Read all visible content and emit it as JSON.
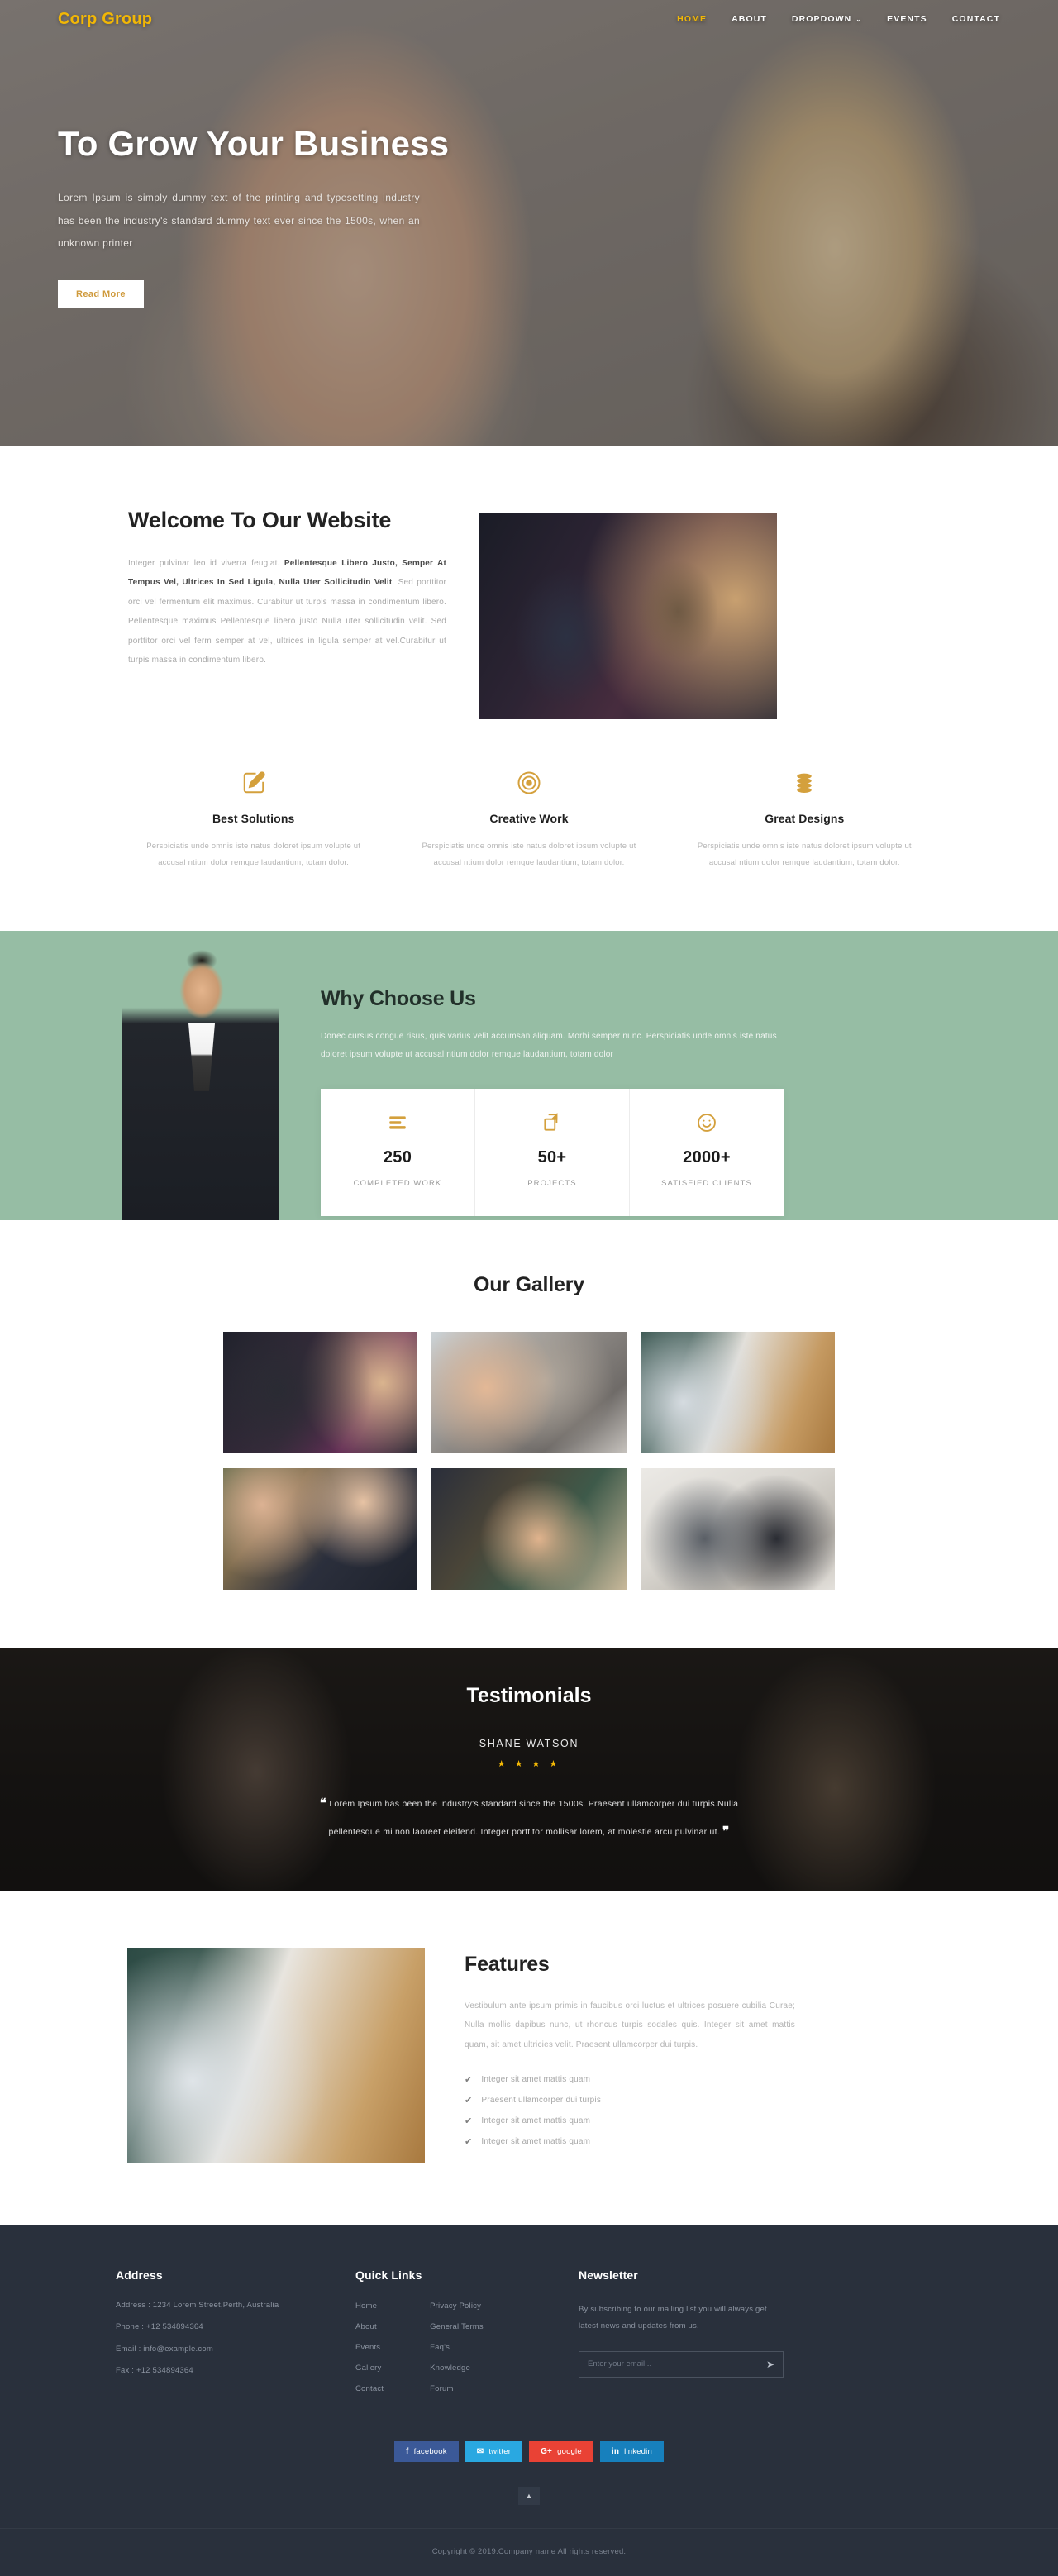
{
  "brand": {
    "logo": "Corp Group",
    "accent": "#f2b705",
    "green": "#96bda4",
    "footer_bg": "#29303c"
  },
  "nav": {
    "items": [
      {
        "label": "HOME",
        "active": true
      },
      {
        "label": "ABOUT",
        "active": false
      },
      {
        "label": "DROPDOWN",
        "active": false,
        "caret": "⌄"
      },
      {
        "label": "EVENTS",
        "active": false
      },
      {
        "label": "CONTACT",
        "active": false
      }
    ]
  },
  "hero": {
    "title": "To Grow Your Business",
    "desc": "Lorem Ipsum is simply dummy text of the printing and typesetting industry has been the industry's standard dummy text ever since the 1500s, when an unknown printer",
    "button": "Read More"
  },
  "welcome": {
    "title": "Welcome To Our Website",
    "lead": "Integer pulvinar leo id viverra feugiat. ",
    "bold": "Pellentesque Libero Justo, Semper At Tempus Vel, Ultrices In Sed Ligula, Nulla Uter Sollicitudin Velit",
    "rest": ". Sed porttitor orci vel fermentum elit maximus. Curabitur ut turpis massa in condimentum libero. Pellentesque maximus Pellentesque libero justo Nulla uter sollicitudin velit. Sed porttitor orci vel ferm semper at vel, ultrices in ligula semper at vel.Curabitur ut turpis massa in condimentum libero."
  },
  "services": [
    {
      "icon": "pencil-edit-icon",
      "title": "Best Solutions",
      "desc": "Perspiciatis unde omnis iste natus doloret ipsum volupte ut accusal ntium dolor remque laudantium, totam dolor."
    },
    {
      "icon": "target-icon",
      "title": "Creative Work",
      "desc": "Perspiciatis unde omnis iste natus doloret ipsum volupte ut accusal ntium dolor remque laudantium, totam dolor."
    },
    {
      "icon": "coins-stack-icon",
      "title": "Great Designs",
      "desc": "Perspiciatis unde omnis iste natus doloret ipsum volupte ut accusal ntium dolor remque laudantium, totam dolor."
    }
  ],
  "why": {
    "title": "Why Choose Us",
    "desc": "Donec cursus congue risus, quis varius velit accumsan aliquam. Morbi semper nunc. Perspiciatis unde omnis iste natus doloret ipsum volupte ut accusal ntium dolor remque laudantium, totam dolor",
    "stats": [
      {
        "icon": "list-bars-icon",
        "number": "250",
        "label": "COMPLETED WORK"
      },
      {
        "icon": "copy-layers-icon",
        "number": "50+",
        "label": "PROJECTS"
      },
      {
        "icon": "smiley-face-icon",
        "number": "2000+",
        "label": "SATISFIED CLIENTS"
      }
    ]
  },
  "gallery": {
    "title": "Our Gallery",
    "count": 6
  },
  "testimonials": {
    "title": "Testimonials",
    "name": "SHANE WATSON",
    "stars": "★ ★ ★ ★",
    "rating": 3.5,
    "quote": "Lorem Ipsum has been the industry's standard since the 1500s. Praesent ullamcorper dui turpis.Nulla pellentesque mi non laoreet eleifend. Integer porttitor mollisar lorem, at molestie arcu pulvinar ut.",
    "open_quote": "❝",
    "close_quote": "❞"
  },
  "features": {
    "title": "Features",
    "desc": "Vestibulum ante ipsum primis in faucibus orci luctus et ultrices posuere cubilia Curae; Nulla mollis dapibus nunc, ut rhoncus turpis sodales quis. Integer sit amet mattis quam, sit amet ultricies velit. Praesent ullamcorper dui turpis.",
    "items": [
      "Integer sit amet mattis quam",
      "Praesent ullamcorper dui turpis",
      "Integer sit amet mattis quam",
      "Integer sit amet mattis quam"
    ]
  },
  "footer": {
    "address": {
      "title": "Address",
      "lines": [
        "Address : 1234 Lorem Street,Perth, Australia",
        "Phone : +12 534894364",
        "Email : info@example.com",
        "Fax : +12 534894364"
      ]
    },
    "quick_links": {
      "title": "Quick Links",
      "col1": [
        "Home",
        "About",
        "Events",
        "Gallery",
        "Contact"
      ],
      "col2": [
        "Privacy Policy",
        "General Terms",
        "Faq's",
        "Knowledge",
        "Forum"
      ]
    },
    "newsletter": {
      "title": "Newsletter",
      "desc": "By subscribing to our mailing list you will always get latest news and updates from us.",
      "placeholder": "Enter your email...",
      "value": "",
      "send_icon": "➤"
    },
    "socials": [
      {
        "name": "facebook",
        "label": "facebook",
        "glyph": "f",
        "color": "#3b5998"
      },
      {
        "name": "twitter",
        "label": "twitter",
        "glyph": "✉",
        "color": "#29a8e1"
      },
      {
        "name": "google",
        "label": "google",
        "glyph": "G+",
        "color": "#e94235"
      },
      {
        "name": "linkedin",
        "label": "linkedin",
        "glyph": "in",
        "color": "#1780bd"
      }
    ],
    "to_top": "▲",
    "copyright": "Copyright © 2019.Company name All rights reserved."
  }
}
